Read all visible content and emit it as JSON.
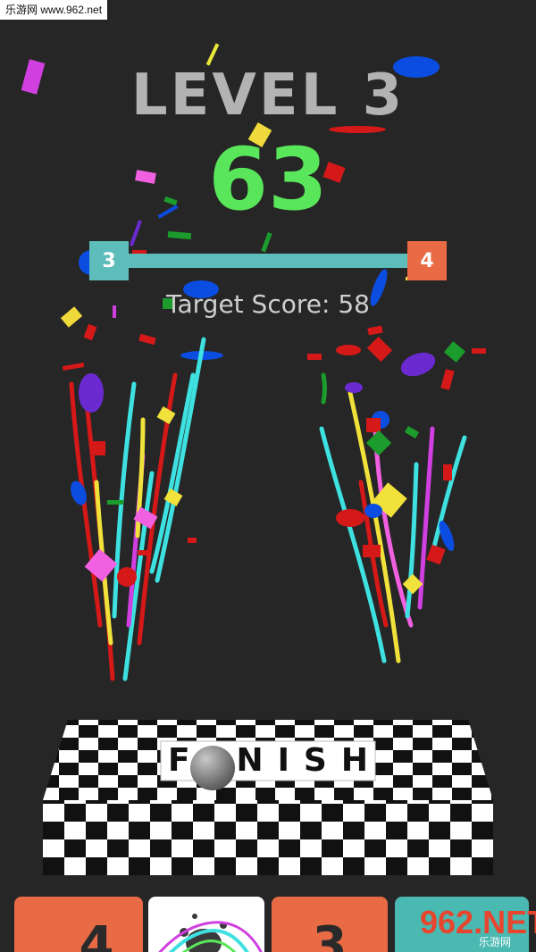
{
  "watermark_top": "乐游网 www.962.net",
  "hud": {
    "level_label": "LEVEL 3",
    "score": "63",
    "target_label": "Target Score: 58"
  },
  "progress": {
    "current_level": "3",
    "next_level": "4",
    "fraction": 1.0
  },
  "finish": {
    "letters": [
      "F",
      "",
      "N",
      "I",
      "S",
      "H"
    ]
  },
  "bottom_tiles": [
    {
      "label": "4",
      "color": "#e86b45"
    },
    {
      "label": "",
      "color": "#ffffff"
    },
    {
      "label": "3",
      "color": "#e86b45"
    },
    {
      "label": "",
      "color": "#4ab9b1"
    }
  ],
  "watermark_bottom": {
    "main": "962.NET",
    "sub": "乐游网"
  },
  "colors": {
    "background": "#262626",
    "level_text": "#b3b3b3",
    "score_text": "#59e65a",
    "bar": "#5dbdbb",
    "next_level_box": "#e86b45"
  },
  "icons": {
    "ball": "ball-icon",
    "splat": "ink-splat-icon"
  }
}
